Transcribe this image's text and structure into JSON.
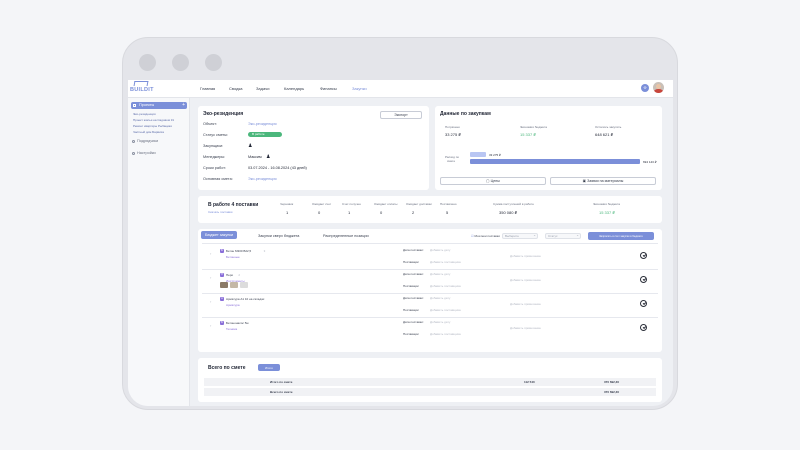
{
  "app": {
    "logo": "BUILDIT"
  },
  "nav": [
    "Главная",
    "Сводка",
    "Задачи",
    "Календарь",
    "Финансы",
    "Закупки"
  ],
  "user": {
    "initial": "Ф"
  },
  "sidebar": {
    "projects": "Проекты",
    "subitems": [
      "Эко-резиденция",
      "Проект жилья на Садовом 31",
      "Ремонт квартиры Рыбацкая",
      "Частный дом Барвиха"
    ],
    "contractors": "Подрядчики",
    "settings": "Настройки"
  },
  "project": {
    "title": "Эко-резиденция",
    "export": "Экспорт",
    "object_label": "Объект:",
    "object_value": "Эко-резиденция",
    "status_label": "Статус сметы:",
    "status_value": "В работе",
    "buyers_label": "Закупщики:",
    "managers_label": "Менеджеры:",
    "managers_value": "Максим",
    "dates_label": "Сроки работ:",
    "dates_value": "03.07.2024 - 16.08.2024 (43 дней)",
    "estimate_label": "Основная смета:",
    "estimate_value": "Эко-резиденция"
  },
  "procurement": {
    "title": "Данные по закупкам",
    "stats": [
      {
        "label": "Потрачено",
        "value": "33 275 ₽"
      },
      {
        "label": "Экономия бюджета",
        "value": "15 337 ₽"
      },
      {
        "label": "Осталось закупить",
        "value": "648 621 ₽"
      }
    ],
    "bar_label_line1": "Расход по",
    "bar_label_line2": "смете",
    "bar1_value": "33 275 ₽",
    "bar2_value": "694 143 ₽",
    "chart_data": {
      "type": "bar",
      "categories": [
        "Потрачено",
        "Всего"
      ],
      "values": [
        33275,
        694143
      ]
    },
    "prices_btn": "Цены",
    "request_btn": "Заявки на материалы"
  },
  "deliveries": {
    "title": "В работе 4 поставки",
    "export_link": "Скачать поставки",
    "stats": [
      {
        "label": "Черновик",
        "value": "1"
      },
      {
        "label": "Ожидает счет",
        "value": "0"
      },
      {
        "label": "Счет получен",
        "value": "1"
      },
      {
        "label": "Ожидает оплаты",
        "value": "0"
      },
      {
        "label": "Ожидает доставки",
        "value": "2"
      },
      {
        "label": "Поставлено",
        "value": "5"
      },
      {
        "label": "Сумма поступлений в работе",
        "value": "350 080 ₽"
      },
      {
        "label": "Экономия бюджета",
        "value": "15 337 ₽"
      }
    ]
  },
  "tabs": [
    "Бюджет закупки",
    "Закупки сверх бюджета",
    "Распределенные позиции"
  ],
  "filters": {
    "only_mine": "Мои мои поставки",
    "select1": "Выберите",
    "select2": "Статус",
    "action_btn": "Запросить в счет закупки в бюджете"
  },
  "items": [
    {
      "name": "Бетон М300 В22,5",
      "tag": "Бетонные",
      "badge": "Б",
      "count": "3",
      "date_label": "Дата поставки:",
      "date_ph": "Добавить дату",
      "supplier_label": "Поставщик:",
      "supplier_ph": "Добавить поставщика",
      "note_ph": "Добавить примечание"
    },
    {
      "name": "Перо",
      "tag": "Инструменты",
      "badge": "П",
      "count": "2",
      "date_label": "Дата поставки:",
      "date_ph": "Добавить дату",
      "supplier_label": "Поставщик:",
      "supplier_ph": "Добавить поставщика",
      "note_ph": "Добавить примечание"
    },
    {
      "name": "Арматура А1 10 на складах",
      "tag": "Арматура",
      "badge": "А",
      "count": "",
      "date_label": "Дата поставки:",
      "date_ph": "Добавить дату",
      "supplier_label": "Поставщик:",
      "supplier_ph": "Добавить поставщика",
      "note_ph": "Добавить примечание"
    },
    {
      "name": "Бетононасос 5м",
      "tag": "Техника",
      "badge": "Б",
      "count": "",
      "date_label": "Дата поставки:",
      "date_ph": "Добавить дату",
      "supplier_label": "Поставщик:",
      "supplier_ph": "Добавить поставщика",
      "note_ph": "Добавить примечание"
    }
  ],
  "summary": {
    "title": "Всего по смете",
    "btn": "Итого",
    "rows": [
      {
        "label": "Итого по смете",
        "mid": "112 540",
        "right": "370 692,30"
      },
      {
        "label": "Всего по смете",
        "mid": "",
        "right": "370 692,30"
      }
    ]
  },
  "colors": {
    "accent": "#7b8fd9",
    "green": "#4bb77c"
  }
}
